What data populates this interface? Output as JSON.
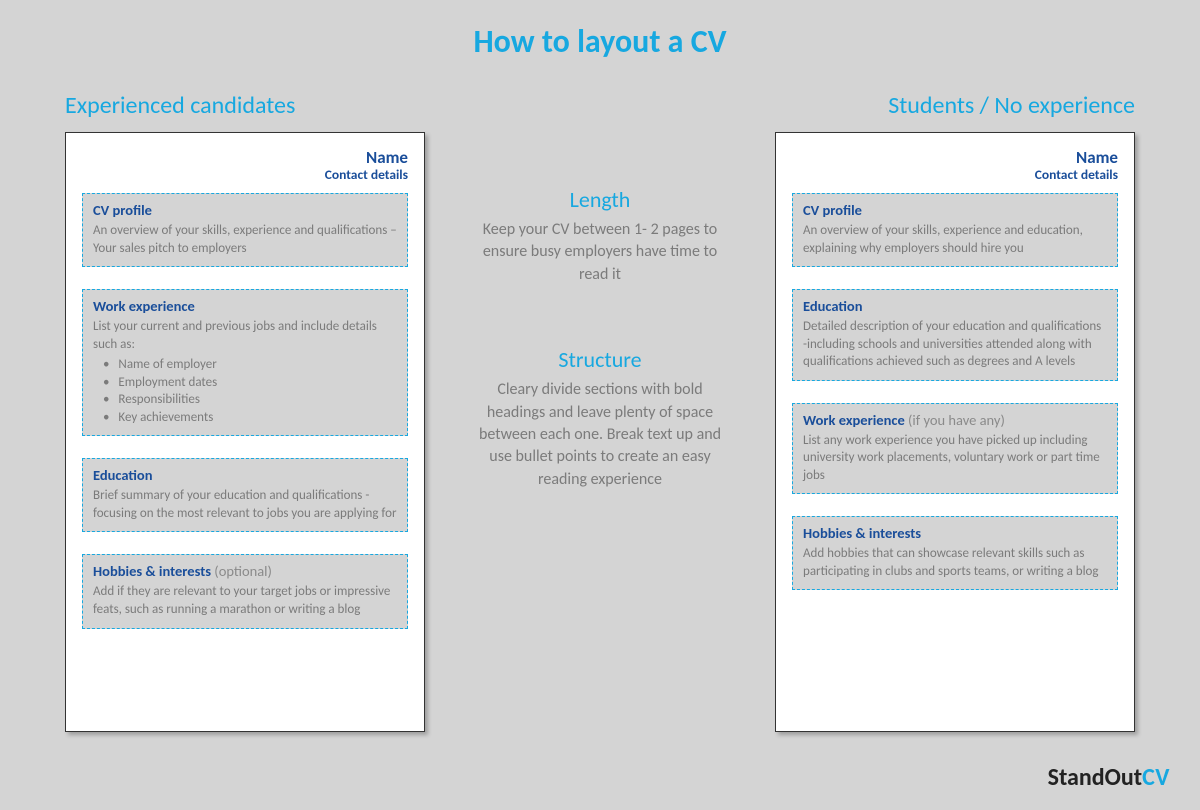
{
  "title": "How to layout a CV",
  "left": {
    "heading": "Experienced candidates",
    "name": "Name",
    "contact": "Contact details",
    "sections": [
      {
        "title": "CV profile",
        "note": "",
        "body": "An overview of your skills, experience and qualifications – Your sales pitch to employers",
        "bullets": []
      },
      {
        "title": "Work experience",
        "note": "",
        "body": "List your current and previous jobs and include details such as:",
        "bullets": [
          "Name of employer",
          "Employment dates",
          "Responsibilities",
          "Key achievements"
        ]
      },
      {
        "title": "Education",
        "note": "",
        "body": "Brief summary of your education and qualifications - focusing on the most relevant to jobs you are applying for",
        "bullets": []
      },
      {
        "title": "Hobbies & interests",
        "note": " (optional)",
        "body": "Add if they are relevant to your target jobs or impressive feats, such as running a marathon or writing a blog",
        "bullets": []
      }
    ]
  },
  "middle": {
    "length": {
      "title": "Length",
      "body": "Keep your CV between 1- 2 pages to ensure busy employers have time to read it"
    },
    "structure": {
      "title": "Structure",
      "body": "Cleary divide sections with bold headings and leave plenty of space between each one. Break text up and use bullet points to create an easy reading experience"
    }
  },
  "right": {
    "heading": "Students / No experience",
    "name": "Name",
    "contact": "Contact details",
    "sections": [
      {
        "title": "CV profile",
        "note": "",
        "body": "An overview of your skills, experience and education,  explaining why employers should hire you",
        "bullets": []
      },
      {
        "title": "Education",
        "note": "",
        "body": "Detailed description of your education and qualifications  -including schools and universities attended along with qualifications achieved such as degrees and A levels",
        "bullets": []
      },
      {
        "title": "Work experience",
        "note": " (if you have any)",
        "body": "List any work experience you have picked up including university work placements, voluntary work or part time jobs",
        "bullets": []
      },
      {
        "title": "Hobbies & interests",
        "note": "",
        "body": "Add hobbies that can showcase relevant skills such as participating in clubs and sports teams, or writing a blog",
        "bullets": []
      }
    ]
  },
  "logo": {
    "a": "StandOut",
    "b": "CV"
  }
}
